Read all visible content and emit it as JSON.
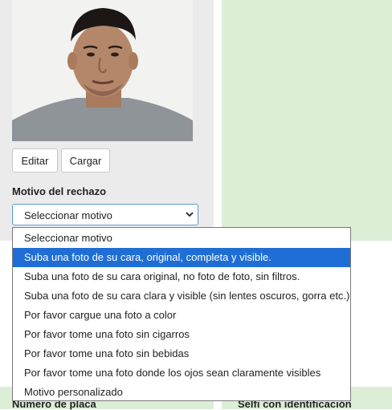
{
  "photo": {
    "alt": "Foto de perfil"
  },
  "buttons": {
    "edit_label": "Editar",
    "upload_label": "Cargar"
  },
  "rejection": {
    "label": "Motivo del rechazo",
    "selected": "Seleccionar motivo",
    "highlighted_index": 1,
    "options": [
      "Seleccionar motivo",
      "Suba una foto de su cara, original, completa y visible.",
      "Suba una foto de su cara original, no foto de foto, sin filtros.",
      "Suba una foto de su cara clara y visible (sin lentes oscuros, gorra etc.)",
      "Por favor cargue una foto a color",
      "Por favor tome una foto sin cigarros",
      "Por favor tome una foto sin bebidas",
      "Por favor tome una foto donde los ojos sean claramente visibles",
      "Motivo personalizado"
    ]
  },
  "bottom": {
    "left_label": "Número de placa",
    "right_label": "Selfi con identificación"
  },
  "colors": {
    "highlight": "#1e6ed5",
    "panel_green": "#dcefd6",
    "panel_gray": "#ebebeb"
  }
}
